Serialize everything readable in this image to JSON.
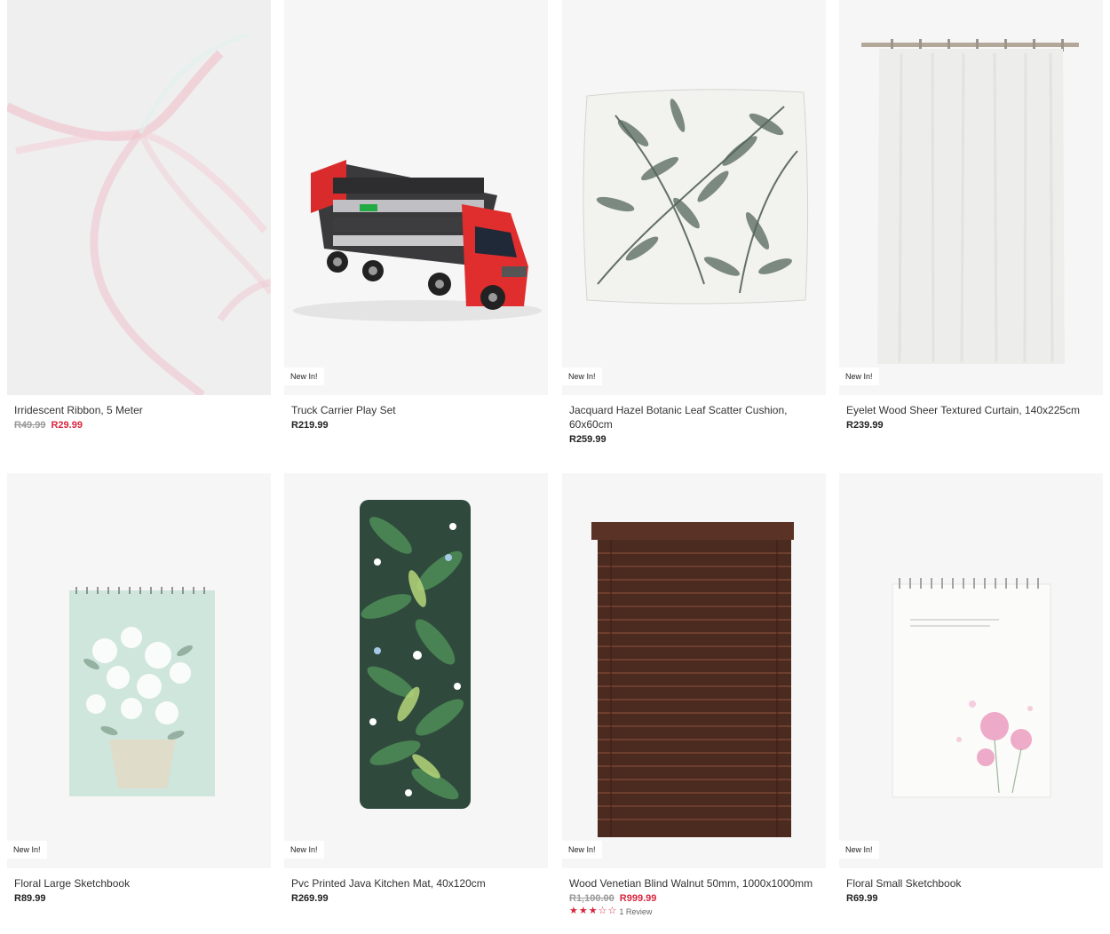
{
  "products": [
    {
      "title": "Irridescent Ribbon, 5 Meter",
      "old_price": "R49.99",
      "price": "R29.99",
      "badge": ""
    },
    {
      "title": "Truck Carrier Play Set",
      "price": "R219.99",
      "badge": "New In!"
    },
    {
      "title": "Jacquard Hazel Botanic Leaf Scatter Cushion, 60x60cm",
      "price": "R259.99",
      "badge": "New In!"
    },
    {
      "title": "Eyelet Wood Sheer Textured Curtain, 140x225cm",
      "price": "R239.99",
      "badge": "New In!"
    },
    {
      "title": "Floral Large Sketchbook",
      "price": "R89.99",
      "badge": "New In!"
    },
    {
      "title": "Pvc Printed Java Kitchen Mat, 40x120cm",
      "price": "R269.99",
      "badge": "New In!"
    },
    {
      "title": "Wood Venetian Blind Walnut 50mm, 1000x1000mm",
      "old_price": "R1,100.00",
      "price": "R999.99",
      "badge": "New In!",
      "rating": 3,
      "review_label": "1 Review"
    },
    {
      "title": "Floral Small Sketchbook",
      "price": "R69.99",
      "badge": "New In!"
    }
  ],
  "colors": {
    "sale": "#d7263d",
    "old": "#9a9a9a",
    "card_bg": "#f6f6f6"
  },
  "icons": [
    "star-filled-icon",
    "star-outline-icon"
  ]
}
